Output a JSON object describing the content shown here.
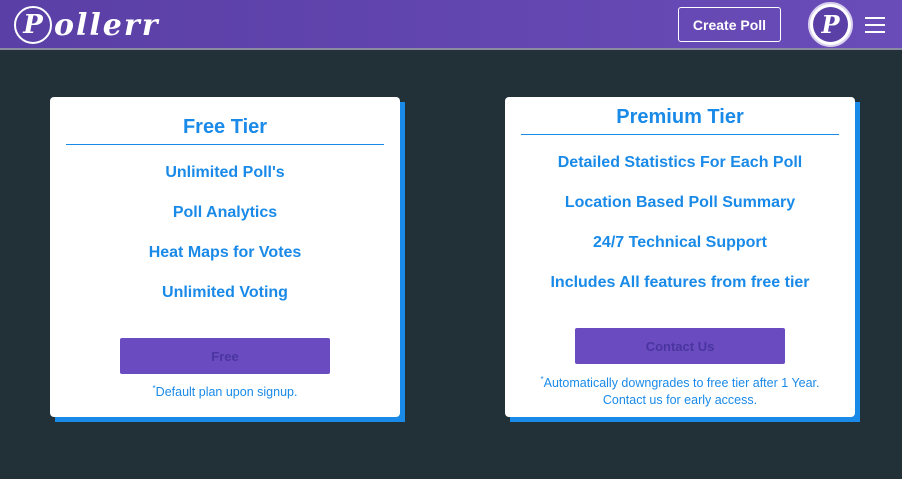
{
  "navbar": {
    "brand_initial": "P",
    "brand_rest": "ollerr",
    "create_poll_label": "Create Poll",
    "avatar_letter": "P",
    "menu_icon": "hamburger-menu-icon"
  },
  "colors": {
    "navbar": "#5a3fa6",
    "background": "#223038",
    "accent_blue": "#1a8ae8",
    "button_purple": "#6a4cc0"
  },
  "free_tier": {
    "title": "Free Tier",
    "features": [
      "Unlimited Poll's",
      "Poll Analytics",
      "Heat Maps for Votes",
      "Unlimited Voting"
    ],
    "button_label": "Free",
    "note_marker": "*",
    "note": "Default plan upon signup."
  },
  "premium_tier": {
    "title": "Premium Tier",
    "features": [
      "Detailed Statistics For Each Poll",
      "Location Based Poll Summary",
      "24/7 Technical Support",
      "Includes All features from free tier"
    ],
    "button_label": "Contact Us",
    "note_marker": "*",
    "note_line1": "Automatically downgrades to free tier after 1 Year.",
    "note_line2": "Contact us for early access."
  }
}
